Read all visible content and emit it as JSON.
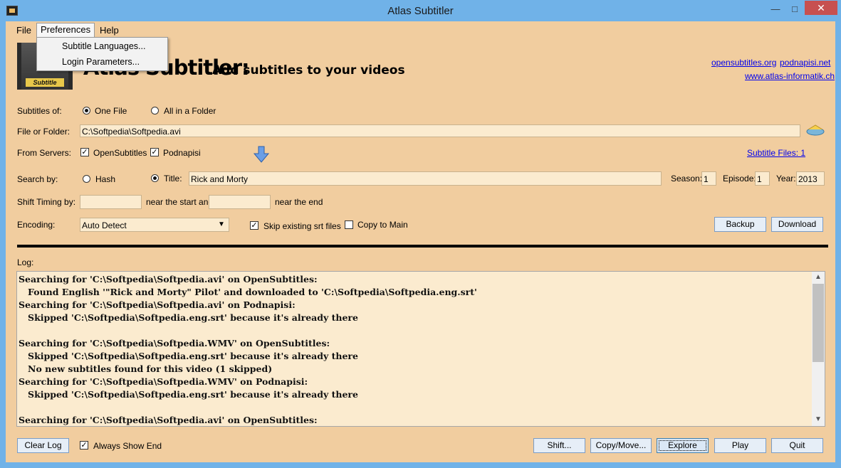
{
  "window": {
    "title": "Atlas Subtitler",
    "minimize": "—",
    "maximize": "□",
    "close": "✕"
  },
  "menu": {
    "file": "File",
    "preferences": "Preferences",
    "help": "Help",
    "dropdown": [
      "Subtitle Languages...",
      "Login Parameters..."
    ]
  },
  "header": {
    "logo_tag": "Subtitle",
    "title": "Atlas Subtitler:",
    "subtitle": "Add subtitles to your videos",
    "links": {
      "opensubtitles": "opensubtitles.org",
      "podnapisi": "podnapisi.net",
      "atlas": "www.atlas-informatik.ch"
    }
  },
  "form": {
    "subtitles_of_label": "Subtitles of:",
    "one_file": "One File",
    "all_in_folder": "All in a Folder",
    "file_label": "File or Folder:",
    "file_value": "C:\\Softpedia\\Softpedia.avi",
    "servers_label": "From Servers:",
    "opensubtitles": "OpenSubtitles",
    "podnapisi": "Podnapisi",
    "subtitle_files": "Subtitle Files: 1",
    "search_by_label": "Search by:",
    "hash": "Hash",
    "title_label": "Title:",
    "title_value": "Rick and Morty",
    "season_label": "Season:",
    "season_value": "1",
    "episode_label": "Episode:",
    "episode_value": "1",
    "year_label": "Year:",
    "year_value": "2013",
    "shift_label": "Shift Timing by:",
    "near_start": "near the start and",
    "near_end": "near the end",
    "shift_start_value": "",
    "shift_end_value": "",
    "encoding_label": "Encoding:",
    "encoding_value": "Auto Detect",
    "skip_existing": "Skip existing srt files",
    "copy_to_main": "Copy to Main",
    "backup": "Backup",
    "download": "Download"
  },
  "log": {
    "label": "Log:",
    "lines": [
      "Searching for 'C:\\Softpedia\\Softpedia.avi' on OpenSubtitles:",
      "   Found English '\"Rick and Morty\" Pilot' and downloaded to 'C:\\Softpedia\\Softpedia.eng.srt'",
      "Searching for 'C:\\Softpedia\\Softpedia.avi' on Podnapisi:",
      "   Skipped 'C:\\Softpedia\\Softpedia.eng.srt' because it's already there",
      "",
      "Searching for 'C:\\Softpedia\\Softpedia.WMV' on OpenSubtitles:",
      "   Skipped 'C:\\Softpedia\\Softpedia.eng.srt' because it's already there",
      "   No new subtitles found for this video (1 skipped)",
      "Searching for 'C:\\Softpedia\\Softpedia.WMV' on Podnapisi:",
      "   Skipped 'C:\\Softpedia\\Softpedia.eng.srt' because it's already there",
      "",
      "Searching for 'C:\\Softpedia\\Softpedia.avi' on OpenSubtitles:"
    ]
  },
  "footer": {
    "clear_log": "Clear Log",
    "always_show_end": "Always Show End",
    "shift": "Shift...",
    "copy_move": "Copy/Move...",
    "explore": "Explore",
    "play": "Play",
    "quit": "Quit"
  }
}
